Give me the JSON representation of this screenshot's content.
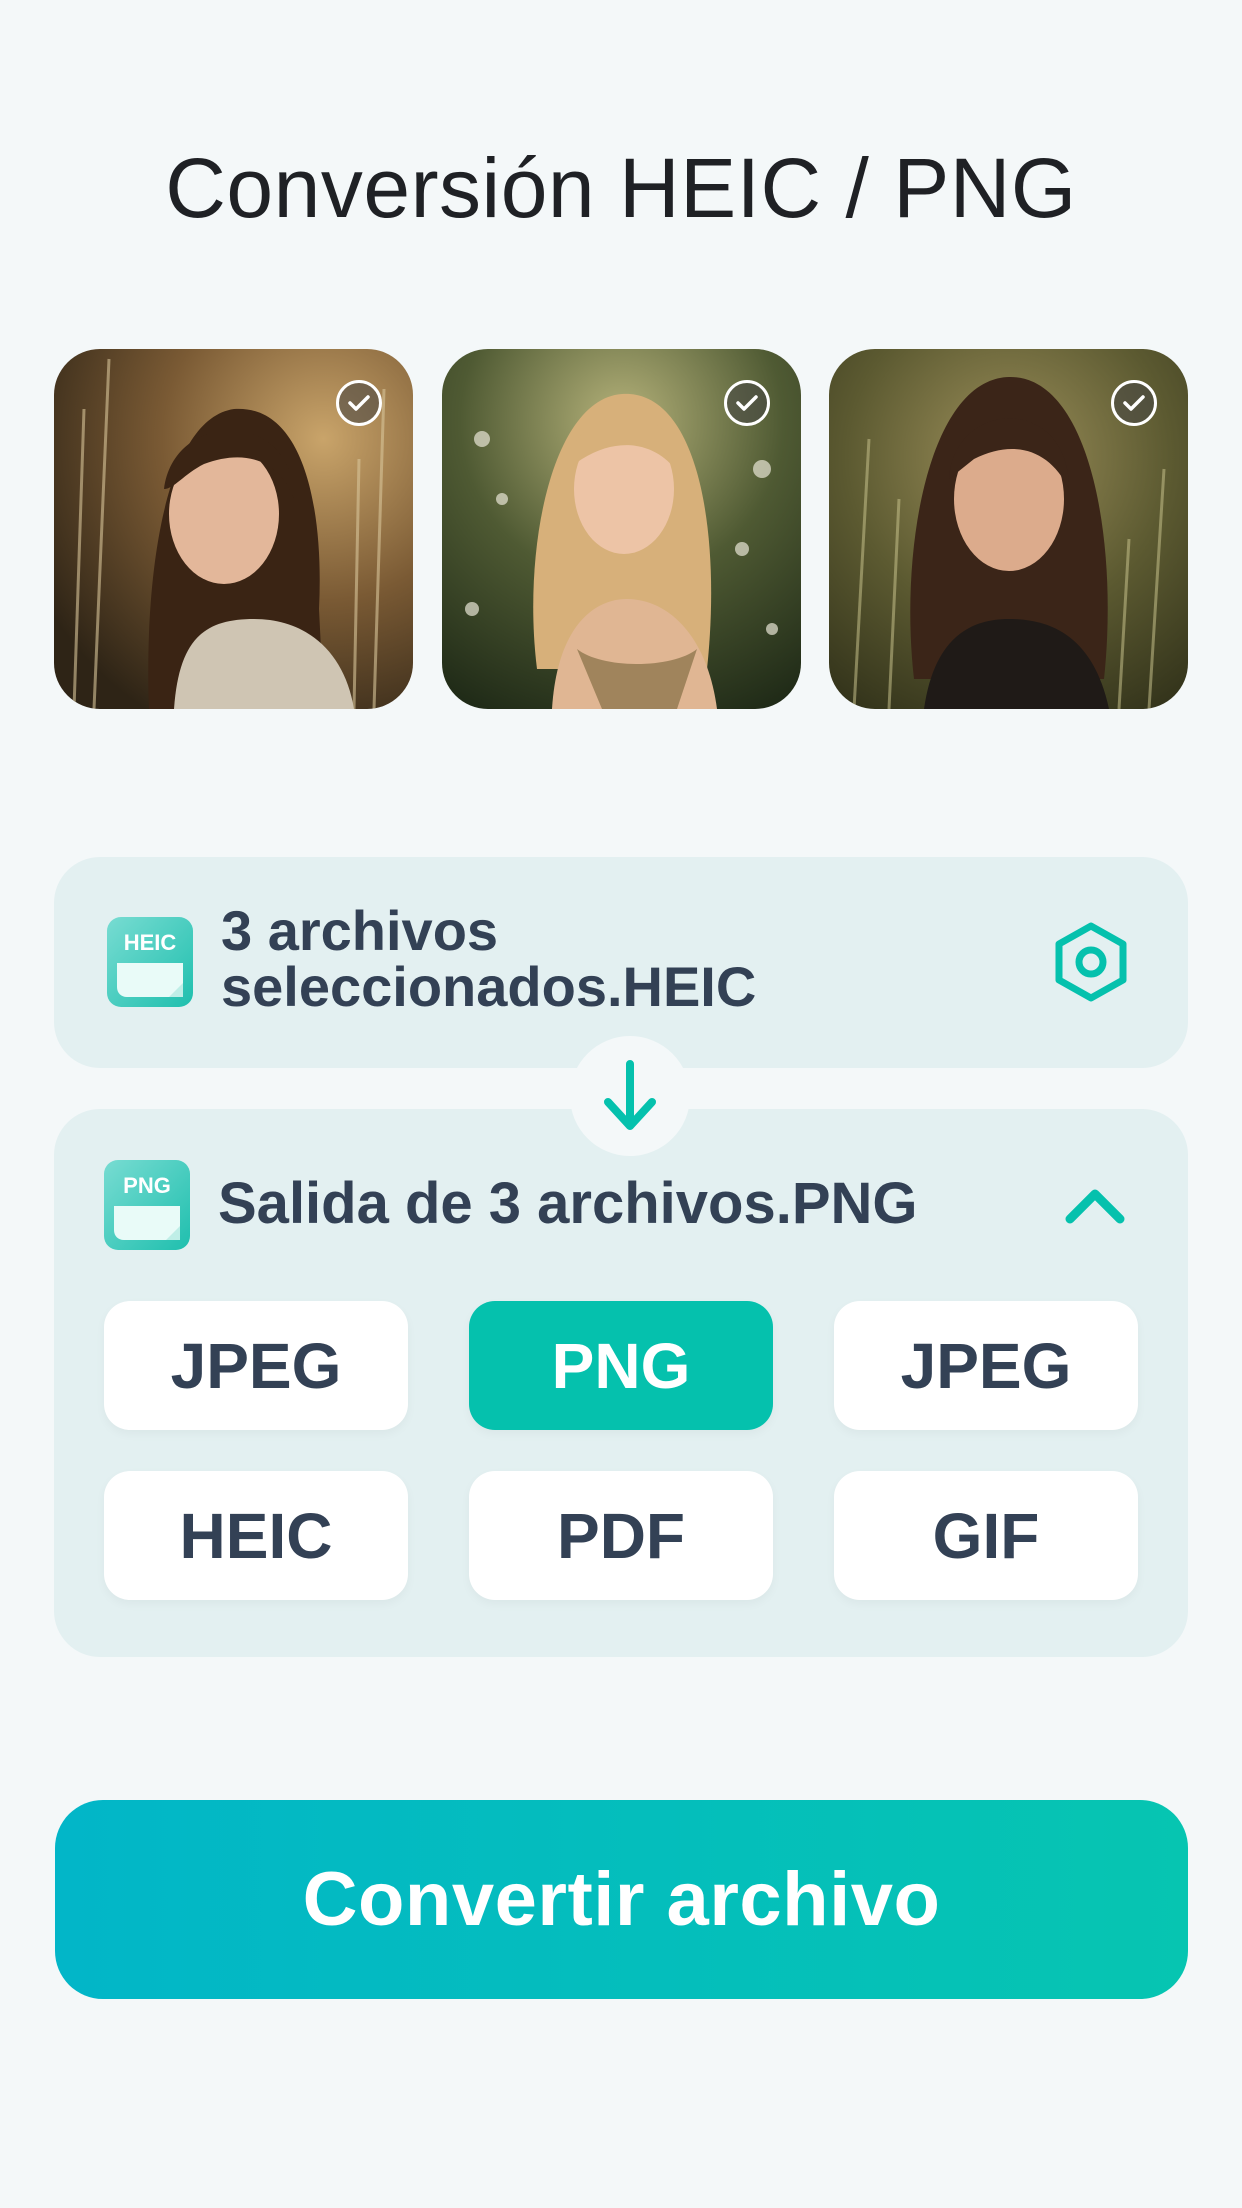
{
  "header": {
    "title": "Conversión HEIC / PNG"
  },
  "images": [
    {
      "name": "photo-1",
      "selected": true
    },
    {
      "name": "photo-2",
      "selected": true
    },
    {
      "name": "photo-3",
      "selected": true
    }
  ],
  "input": {
    "icon": "heic-file-icon",
    "icon_text": "HEIC",
    "line1": "3 archivos",
    "line2": "seleccionados.HEIC",
    "settings_icon": "hexagon-settings-icon"
  },
  "arrow": {
    "icon": "arrow-down-icon"
  },
  "output": {
    "icon": "png-file-icon",
    "icon_text": "PNG",
    "label": "Salida de 3 archivos.PNG",
    "toggle_icon": "chevron-up-icon",
    "formats": [
      "JPEG",
      "PNG",
      "JPEG",
      "HEIC",
      "PDF",
      "GIF"
    ],
    "selected_index": 1
  },
  "action": {
    "convert_label": "Convertir archivo"
  },
  "colors": {
    "accent": "#05c1ad",
    "text": "#334155",
    "card_bg": "#e3f0f1",
    "page_bg": "#f4f8f9"
  }
}
